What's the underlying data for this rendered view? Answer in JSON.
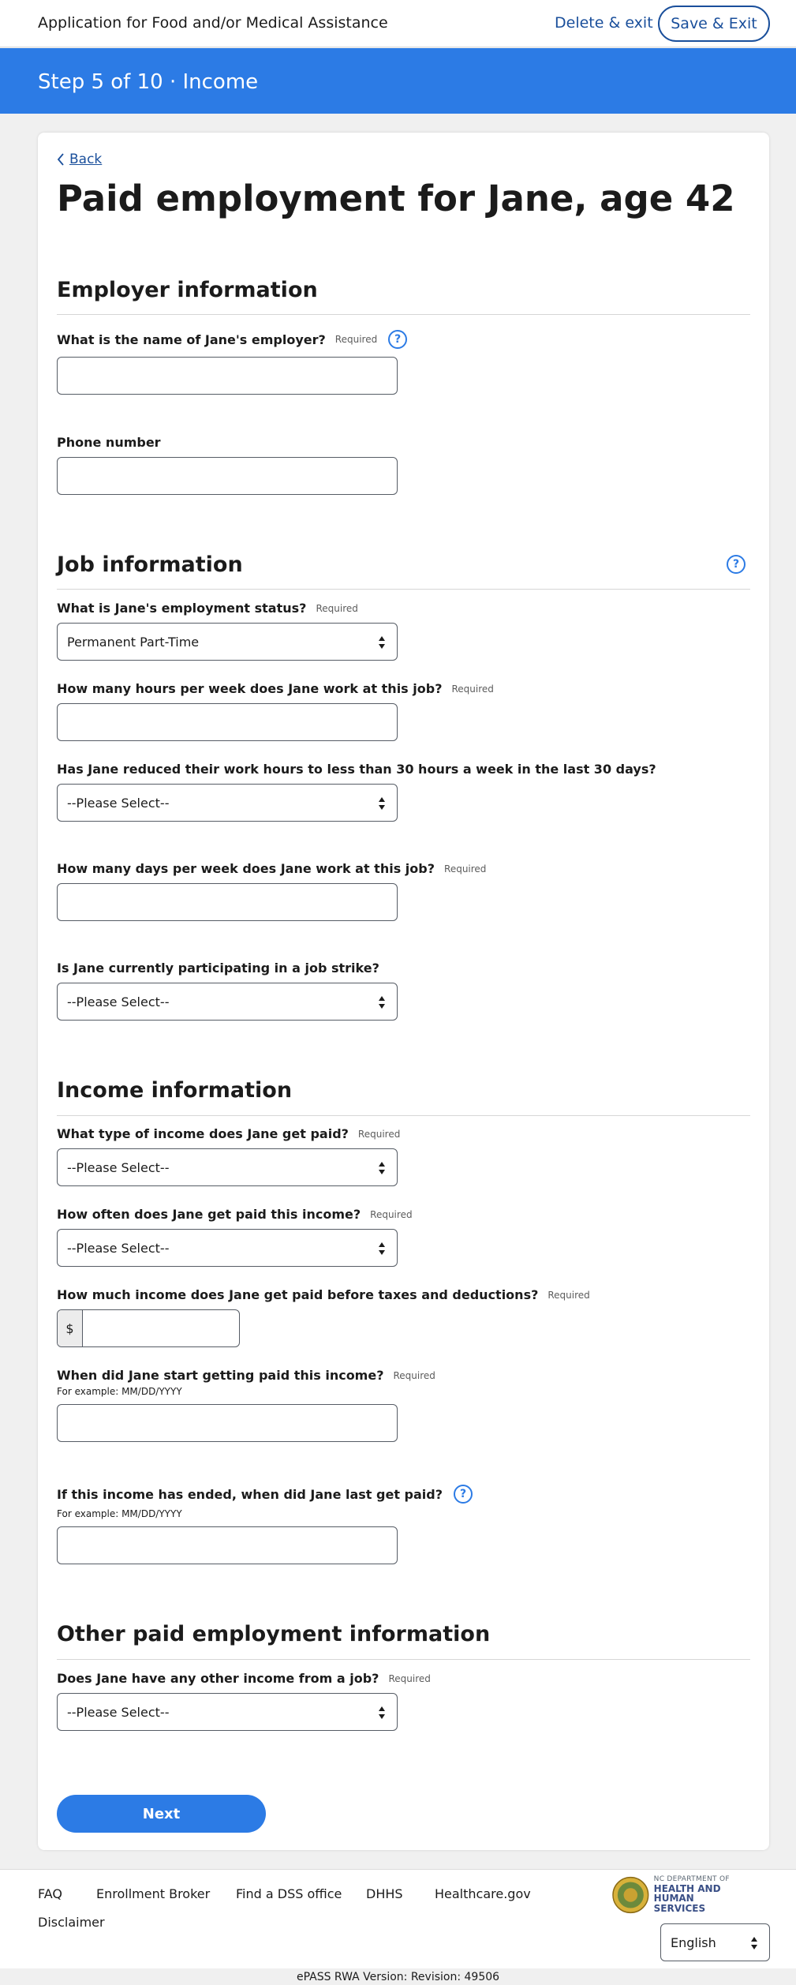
{
  "header": {
    "app_title": "Application for Food and/or Medical Assistance",
    "delete_exit": "Delete & exit",
    "save_exit": "Save & Exit"
  },
  "step": {
    "label": "Step 5 of 10 · Income"
  },
  "back": {
    "label": "Back"
  },
  "page_title": "Paid employment for Jane, age 42",
  "required_label": "Required",
  "help_glyph": "?",
  "employer": {
    "heading": "Employer information",
    "name_q": "What is the name of Jane's employer?",
    "phone_q": "Phone number"
  },
  "job": {
    "heading": "Job information",
    "status_q": "What is Jane's employment status?",
    "status_value": "Permanent Part-Time",
    "hours_q": "How many hours per week does Jane work at this job?",
    "reduced_q": "Has Jane reduced their work hours to less than 30 hours a week in the last 30 days?",
    "reduced_value": "--Please Select--",
    "days_q": "How many days per week does Jane work at this job?",
    "strike_q": "Is Jane currently participating in a job strike?",
    "strike_value": "--Please Select--"
  },
  "income": {
    "heading": "Income information",
    "type_q": "What type of income does Jane get paid?",
    "type_value": "--Please Select--",
    "often_q": "How often does Jane get paid this income?",
    "often_value": "--Please Select--",
    "amount_q": "How much income does Jane get paid before taxes and deductions?",
    "currency": "$",
    "start_q": "When did Jane start getting paid this income?",
    "start_hint": "For example: MM/DD/YYYY",
    "end_q": "If this income has ended, when did Jane last get paid?",
    "end_hint": "For example: MM/DD/YYYY"
  },
  "other": {
    "heading": "Other paid employment information",
    "other_q": "Does Jane have any other income from a job?",
    "other_value": "--Please Select--"
  },
  "next_label": "Next",
  "footer": {
    "links": [
      "FAQ",
      "Enrollment Broker",
      "Find a DSS office",
      "DHHS",
      "Healthcare.gov",
      "Disclaimer"
    ],
    "logo_small": "NC DEPARTMENT OF",
    "logo_big_1": "HEALTH AND",
    "logo_big_2": "HUMAN SERVICES",
    "language": "English",
    "version": "ePASS RWA Version: Revision: 49506"
  },
  "colors": {
    "primary": "#2c7be5",
    "link": "#1a4f9b",
    "card_bg": "#ffffff",
    "page_bg": "#f0f0f0"
  }
}
